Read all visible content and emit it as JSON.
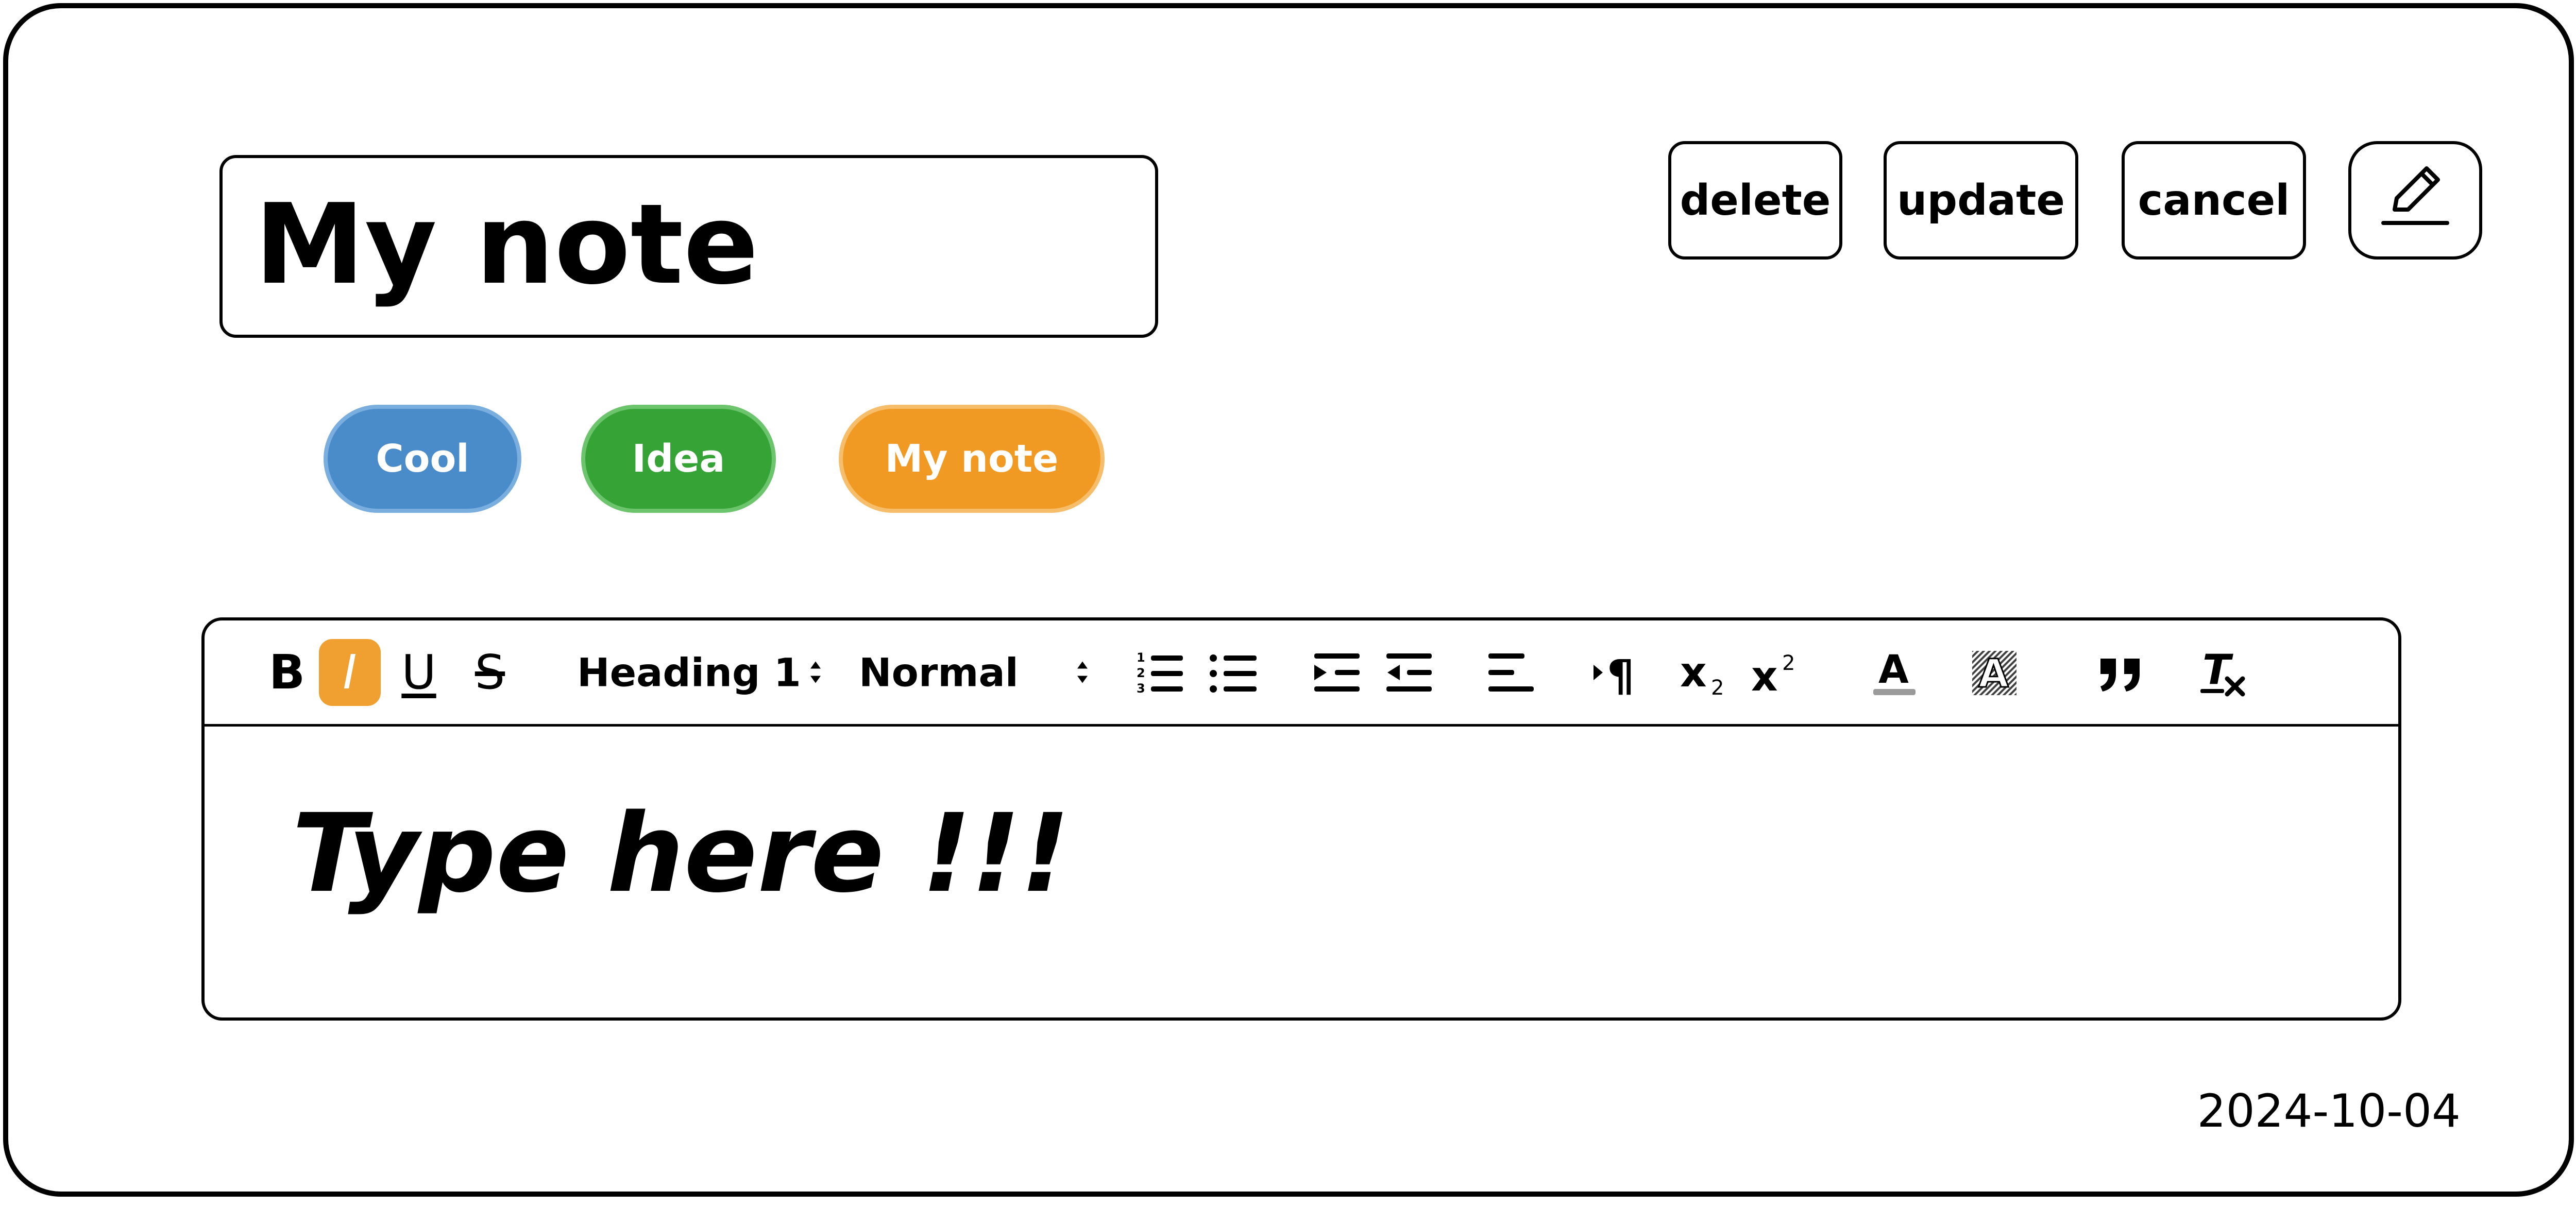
{
  "note": {
    "title": "My note",
    "date": "2024-10-04",
    "content": "Type here !!!"
  },
  "actions": {
    "delete_label": "delete",
    "update_label": "update",
    "cancel_label": "cancel",
    "edit_icon": "pencil-icon"
  },
  "tags": [
    {
      "label": "Cool",
      "color": "#4A8CC9",
      "border": "#7AAEDF"
    },
    {
      "label": "Idea",
      "color": "#36A336",
      "border": "#6CC46C"
    },
    {
      "label": "My note",
      "color": "#F09A24",
      "border": "#F6BE6A"
    }
  ],
  "toolbar": {
    "bold": "B",
    "italic": "I",
    "underline": "U",
    "strike": "S",
    "heading_select": "Heading 1",
    "size_select": "Normal",
    "active_color": "#F0A030",
    "icons": [
      "ordered-list-icon",
      "bullet-list-icon",
      "indent-icon",
      "outdent-icon",
      "align-left-icon",
      "text-direction-icon",
      "subscript-icon",
      "superscript-icon",
      "text-color-icon",
      "background-color-icon",
      "blockquote-icon",
      "clear-format-icon"
    ]
  }
}
